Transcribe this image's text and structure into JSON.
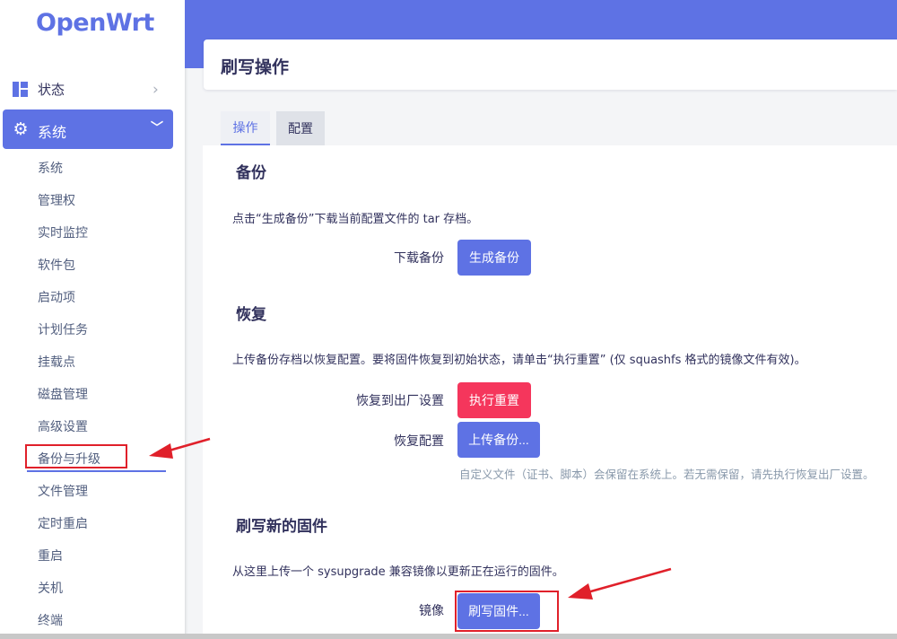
{
  "app": {
    "logo": "OpenWrt"
  },
  "sidebar": {
    "status": {
      "label": "状态",
      "icon": "dashboard-grid-icon"
    },
    "system": {
      "label": "系统",
      "icon": "gear-icon"
    },
    "sub_items": [
      "系统",
      "管理权",
      "实时监控",
      "软件包",
      "启动项",
      "计划任务",
      "挂载点",
      "磁盘管理",
      "高级设置",
      "备份与升级",
      "文件管理",
      "定时重启",
      "重启",
      "关机",
      "终端"
    ],
    "active_index": 9
  },
  "page": {
    "title": "刷写操作",
    "tabs": [
      {
        "label": "操作",
        "active": true
      },
      {
        "label": "配置",
        "active": false
      }
    ]
  },
  "backup": {
    "heading": "备份",
    "description": "点击“生成备份”下载当前配置文件的 tar 存档。",
    "row_label": "下载备份",
    "button": "生成备份"
  },
  "restore": {
    "heading": "恢复",
    "description": "上传备份存档以恢复配置。要将固件恢复到初始状态，请单击“执行重置” (仅 squashfs 格式的镜像文件有效)。",
    "reset_label": "恢复到出厂设置",
    "reset_button": "执行重置",
    "restore_label": "恢复配置",
    "restore_button": "上传备份...",
    "hint": "自定义文件（证书、脚本）会保留在系统上。若无需保留，请先执行恢复出厂设置。"
  },
  "flash": {
    "heading": "刷写新的固件",
    "description": "从这里上传一个 sysupgrade 兼容镜像以更新正在运行的固件。",
    "row_label": "镜像",
    "button": "刷写固件..."
  },
  "colors": {
    "primary": "#5e72e4",
    "danger": "#f5365c",
    "annotation": "#e0202a"
  }
}
